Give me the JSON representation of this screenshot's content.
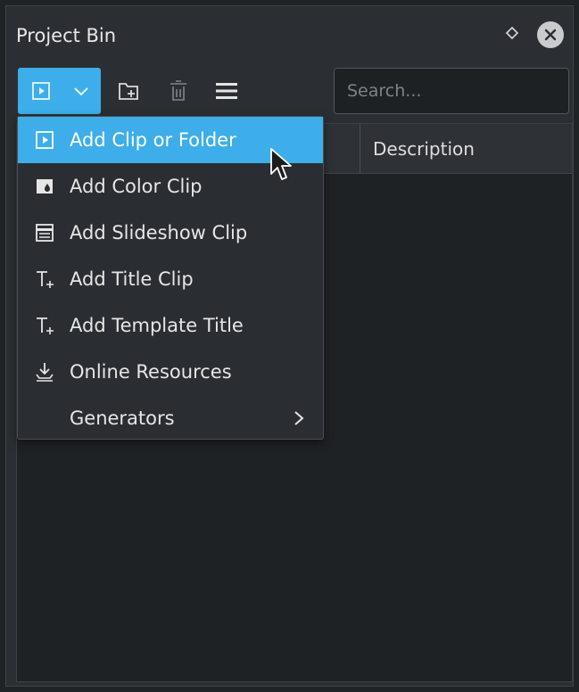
{
  "panel": {
    "title": "Project Bin"
  },
  "toolbar": {
    "add_clip_button": "add-clip-icon",
    "dropdown_icon": "chevron-down-icon",
    "icons": [
      "add-folder-icon",
      "delete-icon",
      "menu-icon"
    ]
  },
  "search": {
    "placeholder": "Search..."
  },
  "table": {
    "columns": [
      "Description"
    ]
  },
  "menu": {
    "items": [
      {
        "label": "Add Clip or Folder",
        "icon": "clip-icon"
      },
      {
        "label": "Add Color Clip",
        "icon": "color-clip-icon"
      },
      {
        "label": "Add Slideshow Clip",
        "icon": "slideshow-icon"
      },
      {
        "label": "Add Title Clip",
        "icon": "title-icon"
      },
      {
        "label": "Add Template Title",
        "icon": "title-icon"
      },
      {
        "label": "Online Resources",
        "icon": "download-icon"
      },
      {
        "label": "Generators",
        "icon": "chevron-right-icon"
      }
    ]
  },
  "colors": {
    "accent": "#3daee9",
    "panel_bg": "#2b2f33",
    "list_bg": "#1f2225"
  }
}
